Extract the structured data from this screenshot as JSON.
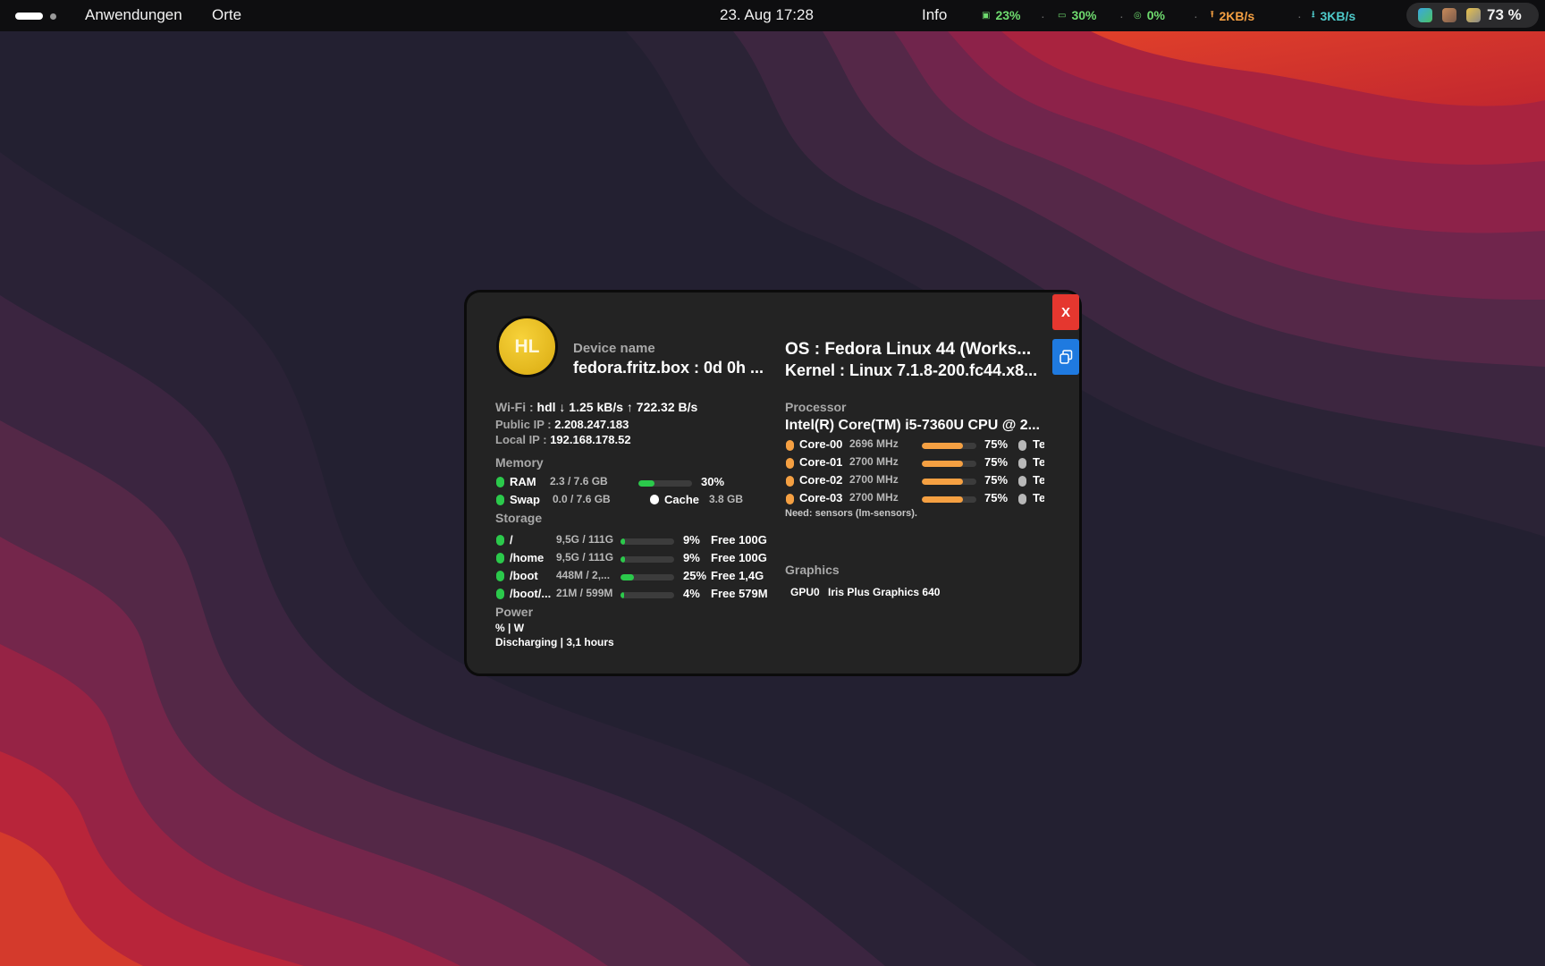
{
  "topbar": {
    "menu_applications": "Anwendungen",
    "menu_places": "Orte",
    "clock": "23. Aug  17:28",
    "info": "Info",
    "cpu_usage": "23%",
    "ram_usage": "30%",
    "disk_usage": "0%",
    "upload_speed": "2KB/s",
    "download_speed": "3KB/s",
    "battery": "73 %",
    "colors": {
      "cpu": "#6fdc6f",
      "ram": "#6fdc6f",
      "disk": "#6fdc6f",
      "upload": "#f5a042",
      "download": "#4ec9c9"
    },
    "icons": [
      "cpu-icon",
      "ram-icon",
      "disk-icon",
      "upload-icon",
      "download-icon",
      "network-tray-icon",
      "user-tray-icon",
      "power-tray-icon"
    ]
  },
  "panel": {
    "avatar_initials": "HL",
    "device_label": "Device name",
    "device_value": "fedora.fritz.box : 0d 0h ...",
    "os": "OS : Fedora Linux 44 (Works...",
    "kernel": "Kernel : Linux 7.1.8-200.fc44.x8...",
    "close_label": "X",
    "network": {
      "wifi_label": "Wi-Fi :",
      "wifi_value": "hdl ↓ 1.25 kB/s ↑ 722.32 B/s",
      "public_ip_label": "Public IP :",
      "public_ip_value": "2.208.247.183",
      "local_ip_label": "Local IP :",
      "local_ip_value": "192.168.178.52"
    },
    "memory": {
      "title": "Memory",
      "ram_label": "RAM",
      "ram_value": "2.3 / 7.6 GB",
      "ram_percent": "30%",
      "ram_fraction": 0.3,
      "swap_label": "Swap",
      "swap_value": "0.0 / 7.6 GB",
      "cache_label": "Cache",
      "cache_value": "3.8 GB"
    },
    "storage": {
      "title": "Storage",
      "rows": [
        {
          "mount": "/",
          "used": "9,5G  / 111G",
          "percent": "9%",
          "fraction": 0.09,
          "free": "Free 100G"
        },
        {
          "mount": "/home",
          "used": "9,5G  / 111G",
          "percent": "9%",
          "fraction": 0.09,
          "free": "Free 100G"
        },
        {
          "mount": "/boot",
          "used": "448M  / 2,...",
          "percent": "25%",
          "fraction": 0.25,
          "free": "Free 1,4G"
        },
        {
          "mount": "/boot/...",
          "used": "21M  / 599M",
          "percent": "4%",
          "fraction": 0.04,
          "free": "Free 579M"
        }
      ]
    },
    "power": {
      "title": "Power",
      "line1": "% | W",
      "line2": "Discharging | 3,1 hours"
    },
    "processor": {
      "title": "Processor",
      "name": "Intel(R) Core(TM) i5-7360U CPU @ 2...",
      "cores": [
        {
          "name": "Core-00",
          "freq": "2696 MHz",
          "percent": "75%",
          "fraction": 0.75,
          "temp": "Te"
        },
        {
          "name": "Core-01",
          "freq": "2700 MHz",
          "percent": "75%",
          "fraction": 0.75,
          "temp": "Te"
        },
        {
          "name": "Core-02",
          "freq": "2700 MHz",
          "percent": "75%",
          "fraction": 0.75,
          "temp": "Te"
        },
        {
          "name": "Core-03",
          "freq": "2700 MHz",
          "percent": "75%",
          "fraction": 0.75,
          "temp": "Te"
        }
      ],
      "sensors_note": "Need: sensors (lm-sensors)."
    },
    "graphics": {
      "title": "Graphics",
      "gpu_label": "GPU0",
      "gpu_name": "Iris Plus Graphics 640"
    }
  }
}
